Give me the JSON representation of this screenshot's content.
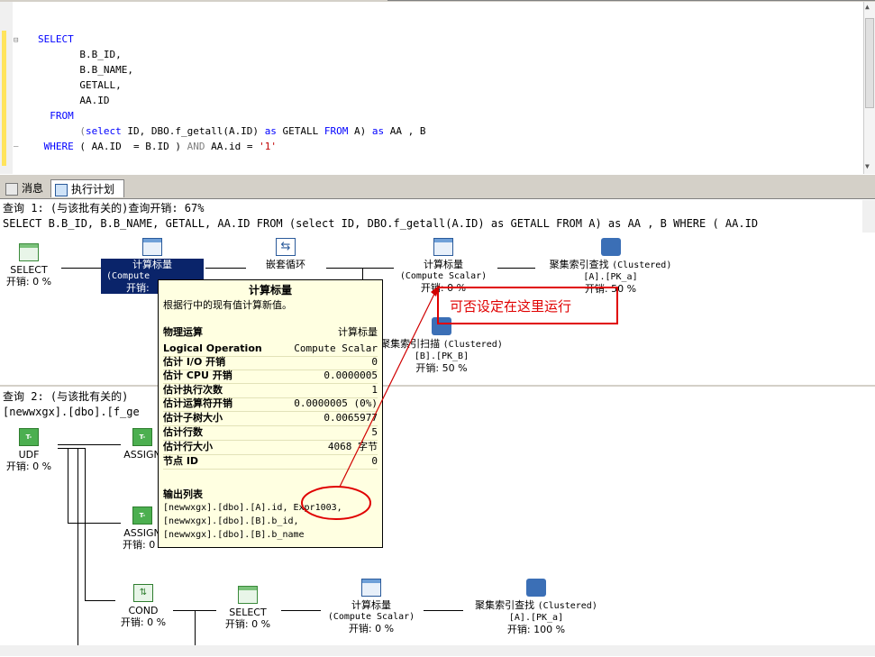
{
  "editor": {
    "lines": [
      {
        "parts": [
          {
            "t": "SELECT",
            "c": "kw"
          }
        ]
      },
      {
        "parts": [
          {
            "t": "       B.B_ID,",
            "c": ""
          }
        ]
      },
      {
        "parts": [
          {
            "t": "       B.B_NAME,",
            "c": ""
          }
        ]
      },
      {
        "parts": [
          {
            "t": "       GETALL,",
            "c": ""
          }
        ]
      },
      {
        "parts": [
          {
            "t": "       AA.ID",
            "c": ""
          }
        ]
      },
      {
        "parts": [
          {
            "t": "  FROM",
            "c": "kw"
          }
        ]
      },
      {
        "parts": [
          {
            "t": "       (",
            "c": "gr"
          },
          {
            "t": "select",
            "c": "kw"
          },
          {
            "t": " ID, DBO.f_getall(A.ID) ",
            "c": ""
          },
          {
            "t": "as",
            "c": "kw"
          },
          {
            "t": " GETALL ",
            "c": ""
          },
          {
            "t": "FROM",
            "c": "kw"
          },
          {
            "t": " A) ",
            "c": ""
          },
          {
            "t": "as",
            "c": "kw"
          },
          {
            "t": " AA , B",
            "c": ""
          }
        ]
      },
      {
        "parts": [
          {
            "t": " WHERE",
            "c": "kw"
          },
          {
            "t": " ( AA.ID  = B.ID ) ",
            "c": ""
          },
          {
            "t": "AND",
            "c": "gr"
          },
          {
            "t": " AA.id = ",
            "c": ""
          },
          {
            "t": "'1'",
            "c": "rd"
          }
        ]
      }
    ]
  },
  "tabs": [
    {
      "label": "消息",
      "icon": "messages-icon"
    },
    {
      "label": "执行计划",
      "icon": "execution-plan-icon"
    }
  ],
  "query1": {
    "header": "查询 1: (与该批有关的)查询开销: 67%",
    "sql": "SELECT B.B_ID, B.B_NAME, GETALL, AA.ID FROM (select ID, DBO.f_getall(A.ID) as GETALL FROM A) as AA , B WHERE ( AA.ID",
    "nodes": {
      "select": {
        "label": "SELECT",
        "cost": "开销: 0 %"
      },
      "compute1": {
        "label": "计算标量",
        "sub": "(Compute",
        "cost": "开销:"
      },
      "loop": {
        "label": "嵌套循环"
      },
      "compute2": {
        "label": "计算标量",
        "sub": "(Compute Scalar)",
        "cost": "开销: 0 %"
      },
      "seek": {
        "label": "聚集索引查找",
        "sub_en": "(Clustered)",
        "obj": "[A].[PK_a]",
        "cost": "开销: 50 %"
      },
      "scan": {
        "label": "聚集索引扫描",
        "sub_en": "(Clustered)",
        "obj": "[B].[PK_B]",
        "cost": "开销: 50 %"
      }
    }
  },
  "query2": {
    "header": "查询 2: (与该批有关的)",
    "sql": "[newwxgx].[dbo].[f_ge",
    "nodes": {
      "udf": {
        "label": "UDF",
        "cost": "开销: 0 %"
      },
      "assign1": {
        "label": "ASSIGN"
      },
      "assign2": {
        "label": "ASSIGN",
        "cost": "开销: 0 %"
      },
      "cond": {
        "label": "COND",
        "cost": "开销: 0 %"
      },
      "select": {
        "label": "SELECT",
        "cost": "开销: 0 %"
      },
      "compute": {
        "label": "计算标量",
        "sub": "(Compute Scalar)",
        "cost": "开销: 0 %"
      },
      "seek": {
        "label": "聚集索引查找",
        "sub_en": "(Clustered)",
        "obj": "[A].[PK_a]",
        "cost": "开销: 100 %"
      }
    },
    "tsql_label": "T-SQL"
  },
  "tooltip": {
    "title": "计算标量",
    "desc": "根据行中的现有值计算新值。",
    "rows": [
      {
        "k": "物理运算",
        "v": "计算标量"
      },
      {
        "k": "Logical Operation",
        "v": "Compute Scalar"
      },
      {
        "k": "估计 I/O 开销",
        "v": "0"
      },
      {
        "k": "估计 CPU 开销",
        "v": "0.0000005"
      },
      {
        "k": "估计执行次数",
        "v": "1"
      },
      {
        "k": "估计运算符开销",
        "v": "0.0000005 (0%)"
      },
      {
        "k": "估计子树大小",
        "v": "0.0065977"
      },
      {
        "k": "估计行数",
        "v": "5"
      },
      {
        "k": "估计行大小",
        "v": "4068 字节"
      },
      {
        "k": "节点 ID",
        "v": "0"
      }
    ],
    "output_title": "输出列表",
    "outputs": [
      "[newwxgx].[dbo].[A].id, Expr1003,",
      "[newwxgx].[dbo].[B].b_id,",
      "[newwxgx].[dbo].[B].b_name"
    ]
  },
  "annotation": {
    "text": "可否设定在这里运行",
    "color": "#e00000"
  },
  "colors": {
    "selection": "#0a246a",
    "tooltip_bg": "#ffffe1",
    "keyword": "#0000ff"
  }
}
